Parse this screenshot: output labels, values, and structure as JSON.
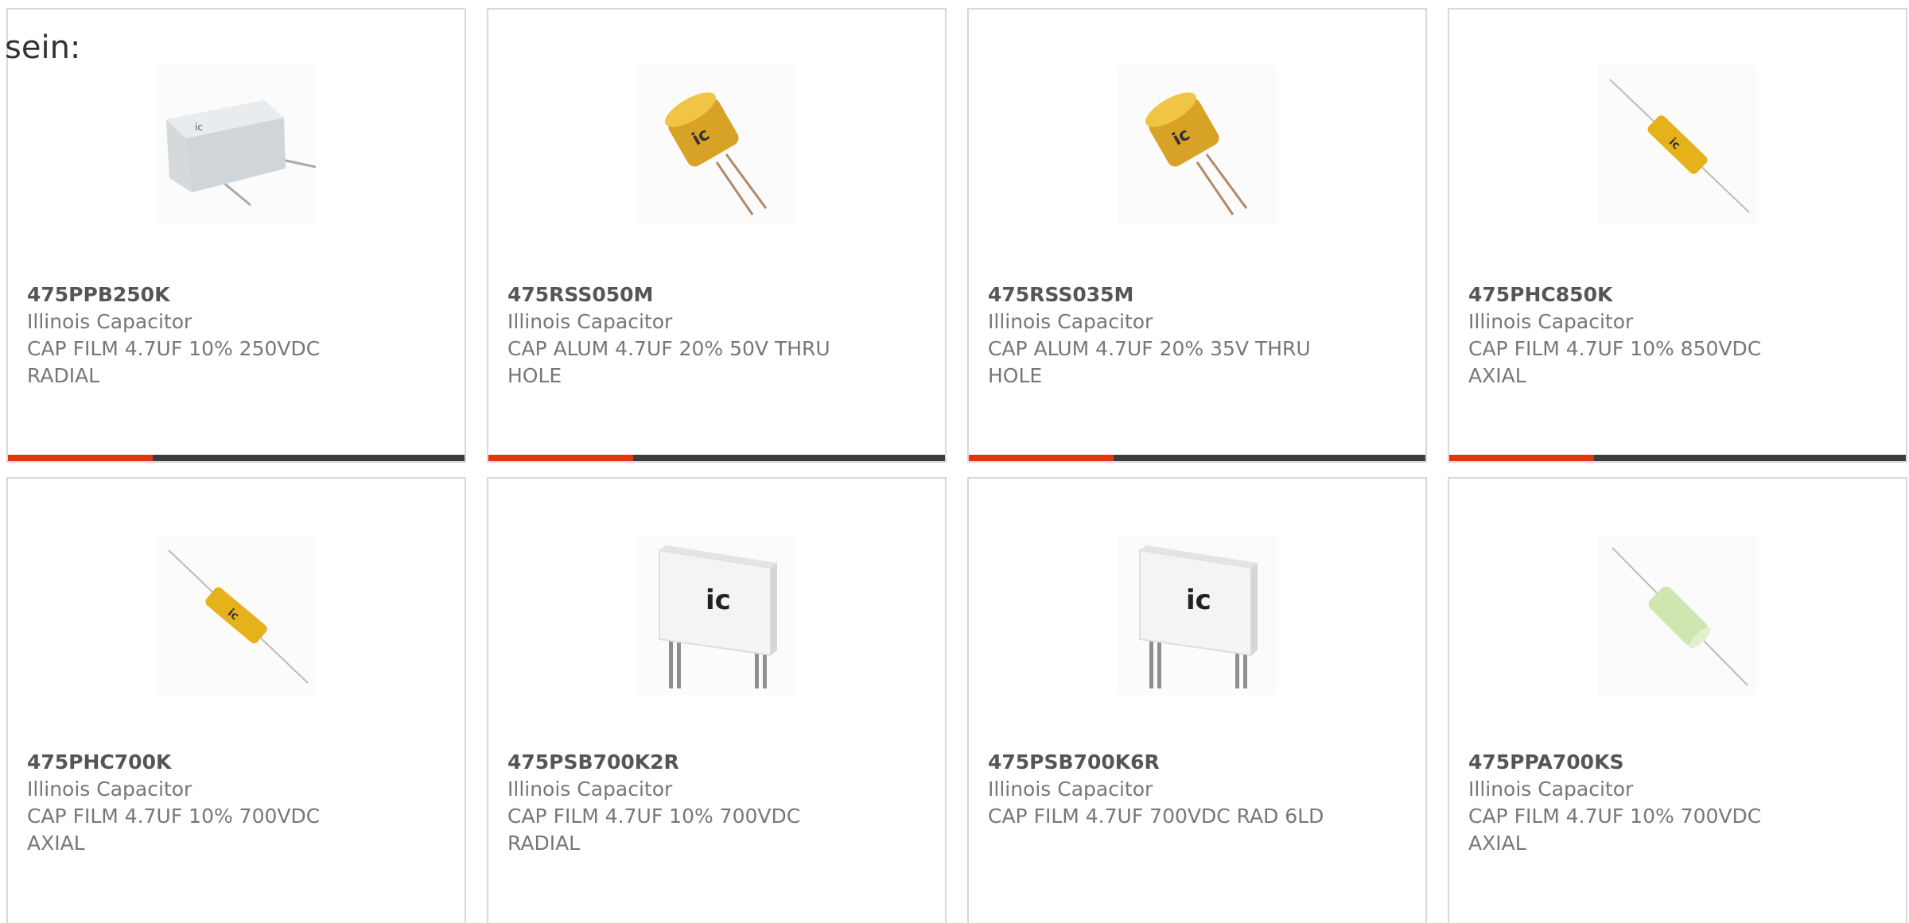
{
  "intro_text": "sein:",
  "colors": {
    "accent": "#e2380f",
    "bar": "#3c3c3c",
    "border": "#d8d8d8"
  },
  "products": [
    {
      "part": "475PPB250K",
      "manufacturer": "Illinois Capacitor",
      "description": "CAP FILM 4.7UF 10% 250VDC RADIAL",
      "image": "film-box-radial-capacitor"
    },
    {
      "part": "475RSS050M",
      "manufacturer": "Illinois Capacitor",
      "description": "CAP ALUM 4.7UF 20% 50V THRU HOLE",
      "image": "aluminum-electrolytic-capacitor"
    },
    {
      "part": "475RSS035M",
      "manufacturer": "Illinois Capacitor",
      "description": "CAP ALUM 4.7UF 20% 35V THRU HOLE",
      "image": "aluminum-electrolytic-capacitor"
    },
    {
      "part": "475PHC850K",
      "manufacturer": "Illinois Capacitor",
      "description": "CAP FILM 4.7UF 10% 850VDC AXIAL",
      "image": "axial-yellow-capacitor"
    },
    {
      "part": "475PHC700K",
      "manufacturer": "Illinois Capacitor",
      "description": "CAP FILM 4.7UF 10% 700VDC AXIAL",
      "image": "axial-yellow-capacitor"
    },
    {
      "part": "475PSB700K2R",
      "manufacturer": "Illinois Capacitor",
      "description": "CAP FILM 4.7UF 10% 700VDC RADIAL",
      "image": "white-box-radial-capacitor"
    },
    {
      "part": "475PSB700K6R",
      "manufacturer": "Illinois Capacitor",
      "description": "CAP FILM 4.7UF 700VDC RAD 6LD",
      "image": "white-box-radial-capacitor"
    },
    {
      "part": "475PPA700KS",
      "manufacturer": "Illinois Capacitor",
      "description": "CAP FILM 4.7UF 10% 700VDC AXIAL",
      "image": "axial-green-capacitor"
    }
  ]
}
